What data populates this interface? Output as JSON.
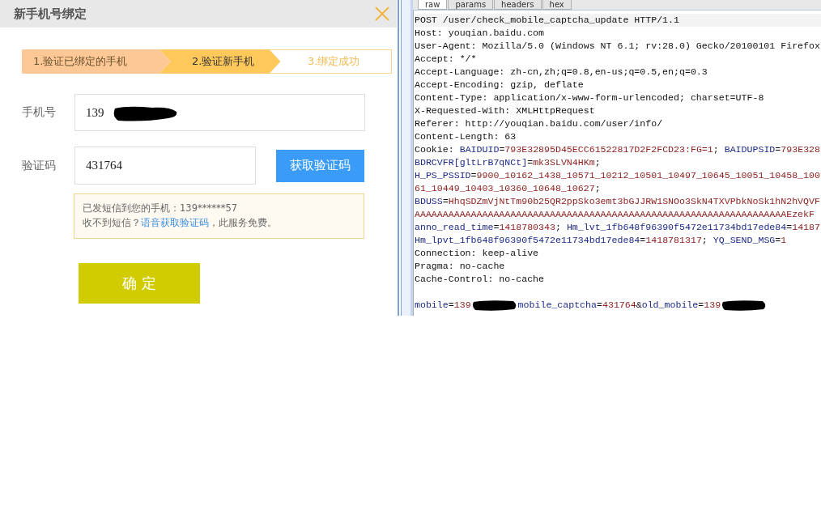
{
  "dialog": {
    "title": "新手机号绑定",
    "steps": [
      {
        "label": "1.验证已绑定的手机",
        "kind": "done"
      },
      {
        "label": "2.验证新手机",
        "kind": "current"
      },
      {
        "label": "3.绑定成功",
        "kind": "pending"
      }
    ],
    "phone": {
      "label": "手机号",
      "value": "139",
      "redacted": true
    },
    "captcha": {
      "label": "验证码",
      "value": "431764",
      "button": "获取验证码"
    },
    "notice": {
      "line1": "已发短信到您的手机：139******57",
      "prefix": "收不到短信？",
      "link": "语音获取验证码",
      "suffix": "，此服务免费。"
    },
    "confirm": "确 定"
  },
  "inspector": {
    "tabs": [
      {
        "label": "raw",
        "selected": true
      },
      {
        "label": "params",
        "selected": false
      },
      {
        "label": "headers",
        "selected": false
      },
      {
        "label": "hex",
        "selected": false
      }
    ],
    "lines": [
      {
        "kind": "text",
        "segments": [
          {
            "kind": "plain",
            "text": "POST /user/check_mobile_captcha_update HTTP/1.1"
          }
        ]
      },
      {
        "kind": "text",
        "segments": [
          {
            "kind": "plain",
            "text": "Host: youqian.baidu.com"
          }
        ]
      },
      {
        "kind": "text",
        "segments": [
          {
            "kind": "plain",
            "text": "User-Agent: Mozilla/5.0 (Windows NT 6.1; rv:28.0) Gecko/20100101 Firefox"
          }
        ]
      },
      {
        "kind": "text",
        "segments": [
          {
            "kind": "plain",
            "text": "Accept: */*"
          }
        ]
      },
      {
        "kind": "text",
        "segments": [
          {
            "kind": "plain",
            "text": "Accept-Language: zh-cn,zh;q=0.8,en-us;q=0.5,en;q=0.3"
          }
        ]
      },
      {
        "kind": "text",
        "segments": [
          {
            "kind": "plain",
            "text": "Accept-Encoding: gzip, deflate"
          }
        ]
      },
      {
        "kind": "text",
        "segments": [
          {
            "kind": "plain",
            "text": "Content-Type: application/x-www-form-urlencoded; charset=UTF-8"
          }
        ]
      },
      {
        "kind": "text",
        "segments": [
          {
            "kind": "plain",
            "text": "X-Requested-With: XMLHttpRequest"
          }
        ]
      },
      {
        "kind": "text",
        "segments": [
          {
            "kind": "plain",
            "text": "Referer: http://youqian.baidu.com/user/info/"
          }
        ]
      },
      {
        "kind": "text",
        "segments": [
          {
            "kind": "plain",
            "text": "Content-Length: 63"
          }
        ]
      },
      {
        "kind": "text",
        "segments": [
          {
            "kind": "plain",
            "text": "Cookie: "
          },
          {
            "kind": "name",
            "text": "BAIDUID"
          },
          {
            "kind": "plain",
            "text": "="
          },
          {
            "kind": "value",
            "text": "793E32895D45ECC61522817D2F2FCD23:FG=1"
          },
          {
            "kind": "plain",
            "text": "; "
          },
          {
            "kind": "name",
            "text": "BAIDUPSID"
          },
          {
            "kind": "plain",
            "text": "="
          },
          {
            "kind": "value",
            "text": "793E328"
          }
        ]
      },
      {
        "kind": "text",
        "segments": [
          {
            "kind": "name",
            "text": "BDRCVFR[gltLrB7qNCt]"
          },
          {
            "kind": "plain",
            "text": "="
          },
          {
            "kind": "value",
            "text": "mk3SLVN4HKm"
          },
          {
            "kind": "plain",
            "text": ";"
          }
        ]
      },
      {
        "kind": "text",
        "segments": [
          {
            "kind": "name",
            "text": "H_PS_PSSID"
          },
          {
            "kind": "plain",
            "text": "="
          },
          {
            "kind": "value",
            "text": "9900_10162_1438_10571_10212_10501_10497_10645_10051_10458_100"
          }
        ]
      },
      {
        "kind": "text",
        "segments": [
          {
            "kind": "value",
            "text": "61_10449_10403_10360_10648_10627"
          },
          {
            "kind": "plain",
            "text": ";"
          }
        ]
      },
      {
        "kind": "text",
        "segments": [
          {
            "kind": "name",
            "text": "BDUSS"
          },
          {
            "kind": "plain",
            "text": "="
          },
          {
            "kind": "value",
            "text": "HhqSDZmVjNtTm90b25QR2ppSko3emt3bGJJRW1SNOo3SkN4TXVPbkNoSk1hN2hVQVF"
          }
        ]
      },
      {
        "kind": "text",
        "segments": [
          {
            "kind": "value",
            "text": "AAAAAAAAAAAAAAAAAAAAAAAAAAAAAAAAAAAAAAAAAAAAAAAAAAAAAAAAAAAAAAAAAAEzekF"
          }
        ]
      },
      {
        "kind": "text",
        "segments": [
          {
            "kind": "name",
            "text": "anno_read_time"
          },
          {
            "kind": "plain",
            "text": "="
          },
          {
            "kind": "value",
            "text": "1418780343"
          },
          {
            "kind": "plain",
            "text": "; "
          },
          {
            "kind": "name",
            "text": "Hm_lvt_1fb648f96390f5472e11734bd17ede84"
          },
          {
            "kind": "plain",
            "text": "="
          },
          {
            "kind": "value",
            "text": "14187"
          }
        ]
      },
      {
        "kind": "text",
        "segments": [
          {
            "kind": "name",
            "text": "Hm_lpvt_1fb648f96390f5472e11734bd17ede84"
          },
          {
            "kind": "plain",
            "text": "="
          },
          {
            "kind": "value",
            "text": "1418781317"
          },
          {
            "kind": "plain",
            "text": "; "
          },
          {
            "kind": "name",
            "text": "YQ_SEND_MSG"
          },
          {
            "kind": "plain",
            "text": "="
          },
          {
            "kind": "value",
            "text": "1"
          }
        ]
      },
      {
        "kind": "text",
        "segments": [
          {
            "kind": "plain",
            "text": "Connection: keep-alive"
          }
        ]
      },
      {
        "kind": "text",
        "segments": [
          {
            "kind": "plain",
            "text": "Pragma: no-cache"
          }
        ]
      },
      {
        "kind": "text",
        "segments": [
          {
            "kind": "plain",
            "text": "Cache-Control: no-cache"
          }
        ]
      },
      {
        "kind": "blank"
      },
      {
        "kind": "text",
        "segments": [
          {
            "kind": "name",
            "text": "mobile"
          },
          {
            "kind": "plain",
            "text": "="
          },
          {
            "kind": "value",
            "text": "139"
          },
          {
            "kind": "redacted"
          },
          {
            "kind": "name",
            "text": "mobile_captcha"
          },
          {
            "kind": "plain",
            "text": "="
          },
          {
            "kind": "value",
            "text": "431764"
          },
          {
            "kind": "plain",
            "text": "&"
          },
          {
            "kind": "name",
            "text": "old_mobile"
          },
          {
            "kind": "plain",
            "text": "="
          },
          {
            "kind": "value",
            "text": "139"
          },
          {
            "kind": "redacted"
          }
        ]
      }
    ]
  }
}
